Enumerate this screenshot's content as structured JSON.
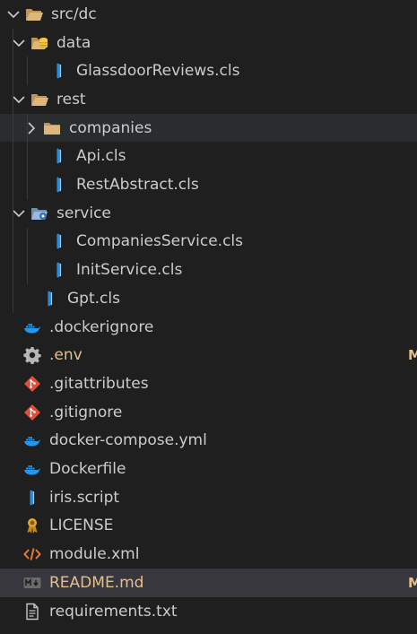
{
  "explorer": {
    "items": [
      {
        "key": "src-dc",
        "label": "src/dc",
        "depth": 0,
        "kind": "folder",
        "open": true,
        "icon": "folder-open-icon"
      },
      {
        "key": "data",
        "label": "data",
        "depth": 1,
        "kind": "folder",
        "open": true,
        "icon": "database-folder-icon"
      },
      {
        "key": "glassdoor",
        "label": "GlassdoorReviews.cls",
        "depth": 2,
        "kind": "file",
        "icon": "objectscript-file-icon"
      },
      {
        "key": "rest",
        "label": "rest",
        "depth": 1,
        "kind": "folder",
        "open": true,
        "icon": "folder-open-icon"
      },
      {
        "key": "companies",
        "label": "companies",
        "depth": 2,
        "kind": "folder",
        "open": false,
        "icon": "folder-closed-icon",
        "state": "hover"
      },
      {
        "key": "api",
        "label": "Api.cls",
        "depth": 2,
        "kind": "file",
        "icon": "objectscript-file-icon"
      },
      {
        "key": "restabstract",
        "label": "RestAbstract.cls",
        "depth": 2,
        "kind": "file",
        "icon": "objectscript-file-icon"
      },
      {
        "key": "service",
        "label": "service",
        "depth": 1,
        "kind": "folder",
        "open": true,
        "icon": "service-folder-icon"
      },
      {
        "key": "companiesservice",
        "label": "CompaniesService.cls",
        "depth": 2,
        "kind": "file",
        "icon": "objectscript-file-icon"
      },
      {
        "key": "initservice",
        "label": "InitService.cls",
        "depth": 2,
        "kind": "file",
        "icon": "objectscript-file-icon"
      },
      {
        "key": "gpt",
        "label": "Gpt.cls",
        "depth": 1,
        "kind": "file",
        "icon": "objectscript-file-icon"
      },
      {
        "key": "dockerignore",
        "label": ".dockerignore",
        "depth": 0,
        "kind": "file",
        "icon": "docker-icon"
      },
      {
        "key": "env",
        "label": ".env",
        "depth": 0,
        "kind": "file",
        "icon": "gear-icon",
        "modified": true,
        "badge": "M"
      },
      {
        "key": "gitattributes",
        "label": ".gitattributes",
        "depth": 0,
        "kind": "file",
        "icon": "git-icon"
      },
      {
        "key": "gitignore",
        "label": ".gitignore",
        "depth": 0,
        "kind": "file",
        "icon": "git-icon"
      },
      {
        "key": "dockercompose",
        "label": "docker-compose.yml",
        "depth": 0,
        "kind": "file",
        "icon": "docker-icon"
      },
      {
        "key": "dockerfile",
        "label": "Dockerfile",
        "depth": 0,
        "kind": "file",
        "icon": "docker-icon"
      },
      {
        "key": "irisscript",
        "label": "iris.script",
        "depth": 0,
        "kind": "file",
        "icon": "objectscript-file-icon"
      },
      {
        "key": "license",
        "label": "LICENSE",
        "depth": 0,
        "kind": "file",
        "icon": "license-icon"
      },
      {
        "key": "modulexml",
        "label": "module.xml",
        "depth": 0,
        "kind": "file",
        "icon": "xml-icon"
      },
      {
        "key": "readme",
        "label": "README.md",
        "depth": 0,
        "kind": "file",
        "icon": "markdown-icon",
        "modified": true,
        "badge": "M",
        "state": "selected"
      },
      {
        "key": "requirements",
        "label": "requirements.txt",
        "depth": 0,
        "kind": "file",
        "icon": "text-file-icon"
      }
    ]
  },
  "colors": {
    "background": "#1f1f1f",
    "text": "#cccccc",
    "modified": "#e2c08d",
    "hover": "#2a2d2e",
    "selected": "#37373d",
    "folder": "#c09553",
    "objectscript": "#2b8cd6",
    "docker": "#2496ed",
    "git": "#e44c3a",
    "xml": "#e37933"
  }
}
